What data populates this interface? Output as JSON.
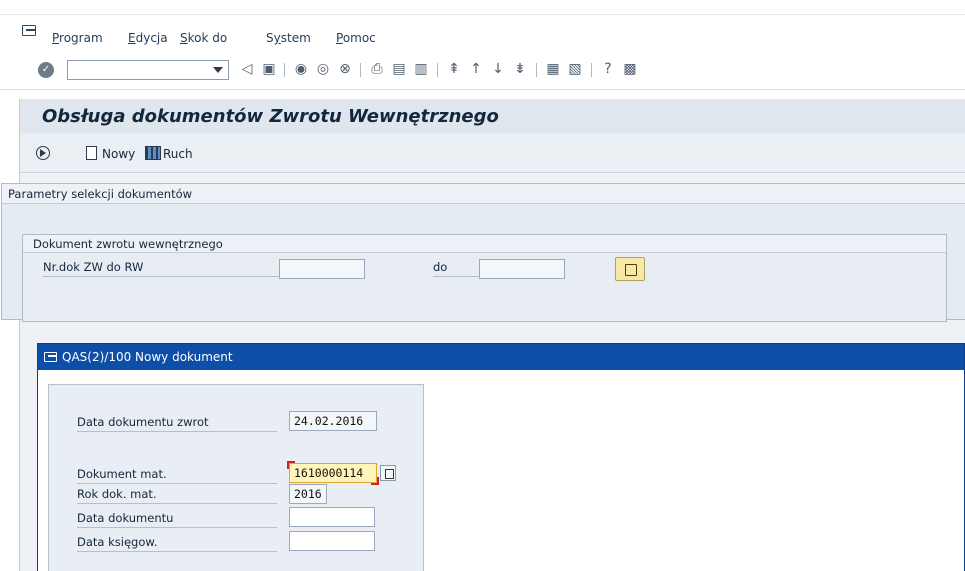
{
  "menubar": {
    "items": [
      {
        "prefix": "",
        "underlined": "P",
        "rest": "rogram"
      },
      {
        "prefix": "",
        "underlined": "E",
        "rest": "dycja"
      },
      {
        "prefix": "",
        "underlined": "S",
        "rest": "kok do"
      },
      {
        "prefix": "S",
        "underlined": "y",
        "rest": "stem"
      },
      {
        "prefix": "",
        "underlined": "P",
        "rest": "omoc"
      }
    ]
  },
  "toolbar": {
    "command_value": ""
  },
  "screen": {
    "title": "Obsługa dokumentów Zwrotu Wewnętrznego",
    "buttons": {
      "new_label": "Nowy",
      "movement_label": "Ruch"
    }
  },
  "selection": {
    "outer_title": "Parametry selekcji dokumentów",
    "inner_title": "Dokument zwrotu wewnętrznego",
    "field_label": "Nr.dok ZW do RW",
    "to_label": "do",
    "from_value": "",
    "to_value": ""
  },
  "popup": {
    "title": "QAS(2)/100 Nowy dokument",
    "fields": {
      "return_date_label": "Data dokumentu zwrot",
      "return_date_value": "24.02.2016",
      "mat_doc_label": "Dokument mat.",
      "mat_doc_value": "1610000114",
      "mat_year_label": "Rok dok. mat.",
      "mat_year_value": "2016",
      "doc_date_label": "Data dokumentu",
      "doc_date_value": "",
      "posting_date_label": "Data księgow.",
      "posting_date_value": ""
    }
  }
}
